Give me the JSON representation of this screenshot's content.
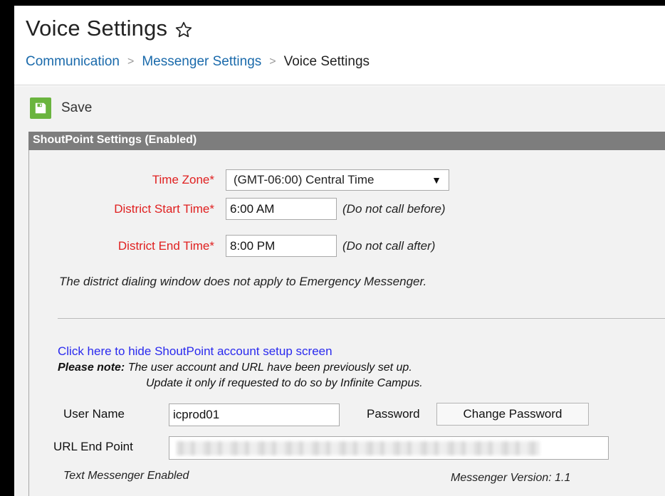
{
  "header": {
    "title": "Voice Settings",
    "breadcrumb": [
      "Communication",
      "Messenger Settings",
      "Voice Settings"
    ]
  },
  "toolbar": {
    "save_label": "Save"
  },
  "panel": {
    "title": "ShoutPoint Settings (Enabled)",
    "time_zone_label": "Time Zone*",
    "time_zone_value": "(GMT-06:00) Central Time",
    "start_label": "District Start Time*",
    "start_value": "6:00 AM",
    "start_hint": "(Do not call before)",
    "end_label": "District End Time*",
    "end_value": "8:00 PM",
    "end_hint": "(Do not call after)",
    "window_note": "The district dialing window does not apply to Emergency Messenger."
  },
  "account": {
    "hide_link": "Click here to hide ShoutPoint account setup screen",
    "note_bold": "Please note:",
    "note_text": " The user account and URL have been previously set up.",
    "note_text2": "Update it only if requested to do so by Infinite Campus.",
    "username_label": "User Name",
    "username_value": "icprod01",
    "password_label": "Password",
    "change_password": "Change Password",
    "url_label": "URL End Point",
    "text_messenger": "Text Messenger Enabled",
    "messenger_version": "Messenger Version: 1.1"
  },
  "colors": {
    "accent_link": "#1a6aab",
    "required_label": "#e02020",
    "save_green": "#6ab43e",
    "panel_header": "#7d7d7d"
  },
  "icons": {
    "favorite": "star-outline-icon",
    "save": "floppy-disk-icon",
    "dropdown": "triangle-down-icon"
  }
}
